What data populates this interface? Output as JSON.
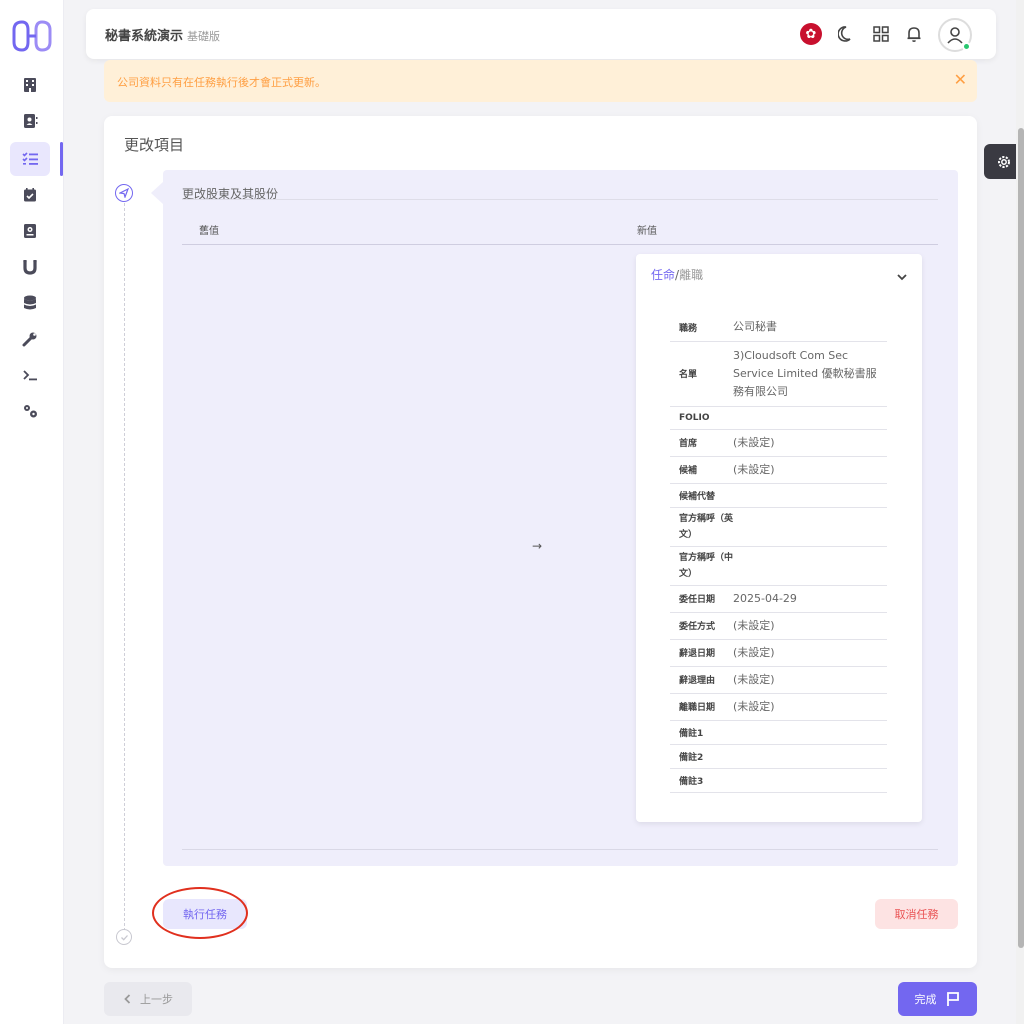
{
  "sidebar": {
    "logo_icon": "logo-icon",
    "items": [
      {
        "icon": "building-icon"
      },
      {
        "icon": "contact-book-icon"
      },
      {
        "icon": "checklist-icon",
        "active": true
      },
      {
        "icon": "calendar-check-icon"
      },
      {
        "icon": "address-book-icon"
      },
      {
        "icon": "magnet-icon"
      },
      {
        "icon": "database-icon"
      },
      {
        "icon": "wrench-icon"
      },
      {
        "icon": "terminal-icon"
      },
      {
        "icon": "gears-icon"
      }
    ]
  },
  "header": {
    "title": "秘書系統演示",
    "edition": "基礎版",
    "icons": [
      "hk-flag-icon",
      "moon-icon",
      "grid-icon",
      "bell-icon",
      "user-icon"
    ]
  },
  "alert": {
    "message": "公司資料只有在任務執行後才會正式更新。",
    "close": "✕"
  },
  "card": {
    "title": "更改項目",
    "change": {
      "title": "更改股東及其股份",
      "old_header": "舊值",
      "new_header": "新值",
      "arrow": "→",
      "detail": {
        "heading_a": "任命",
        "heading_sep": "/",
        "heading_b": "離職",
        "rows": [
          {
            "label": "職務",
            "value": "公司秘書"
          },
          {
            "label": "名單",
            "value": "3)Cloudsoft Com Sec Service Limited 優軟秘書服務有限公司"
          },
          {
            "label": "FOLIO",
            "value": ""
          },
          {
            "label": "首席",
            "value": "(未設定)"
          },
          {
            "label": "候補",
            "value": "(未設定)"
          },
          {
            "label": "候補代替",
            "value": ""
          },
          {
            "label": "官方稱呼（英文）",
            "value": ""
          },
          {
            "label": "官方稱呼（中文）",
            "value": ""
          },
          {
            "label": "委任日期",
            "value": "2025-04-29"
          },
          {
            "label": "委任方式",
            "value": "(未設定)"
          },
          {
            "label": "辭退日期",
            "value": "(未設定)"
          },
          {
            "label": "辭退理由",
            "value": "(未設定)"
          },
          {
            "label": "離職日期",
            "value": "(未設定)"
          },
          {
            "label": "備註1",
            "value": ""
          },
          {
            "label": "備註2",
            "value": ""
          },
          {
            "label": "備註3",
            "value": ""
          }
        ]
      }
    },
    "execute_label": "執行任務",
    "cancel_label": "取消任務"
  },
  "footer": {
    "prev_label": "上一步",
    "done_label": "完成"
  },
  "colors": {
    "accent": "#7367f0",
    "warning": "#ff9f43",
    "danger": "#ea5455",
    "annotation": "#e0301e"
  }
}
